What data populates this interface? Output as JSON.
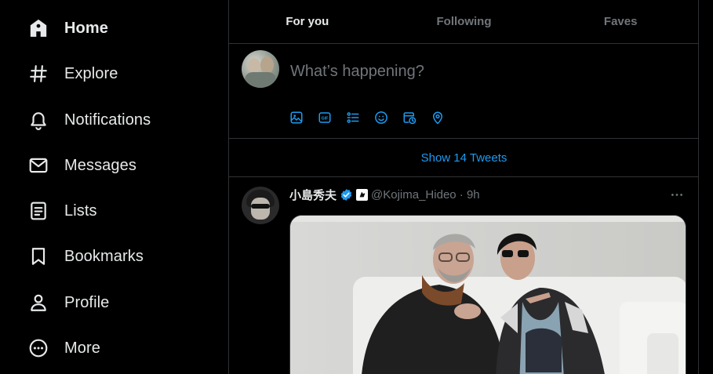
{
  "sidebar": {
    "items": [
      {
        "label": "Home",
        "icon": "home-icon"
      },
      {
        "label": "Explore",
        "icon": "hashtag-icon"
      },
      {
        "label": "Notifications",
        "icon": "bell-icon"
      },
      {
        "label": "Messages",
        "icon": "envelope-icon"
      },
      {
        "label": "Lists",
        "icon": "list-icon"
      },
      {
        "label": "Bookmarks",
        "icon": "bookmark-icon"
      },
      {
        "label": "Profile",
        "icon": "person-icon"
      },
      {
        "label": "More",
        "icon": "more-circle-icon"
      }
    ],
    "active": "Home"
  },
  "tabs": [
    {
      "label": "For you",
      "active": true
    },
    {
      "label": "Following",
      "active": false
    },
    {
      "label": "Faves",
      "active": false
    }
  ],
  "composer": {
    "placeholder": "What’s happening?",
    "tools": [
      "image-icon",
      "gif-icon",
      "poll-icon",
      "emoji-icon",
      "schedule-icon",
      "location-icon"
    ]
  },
  "show_tweets": "Show 14 Tweets",
  "tweet": {
    "name": "小島秀夫",
    "handle": "@Kojima_Hideo · 9h",
    "verified": true
  },
  "colors": {
    "accent": "#1d9bf0",
    "background": "#000000",
    "text": "#e7e9ea",
    "muted": "#71767b",
    "border": "#2f3336"
  }
}
